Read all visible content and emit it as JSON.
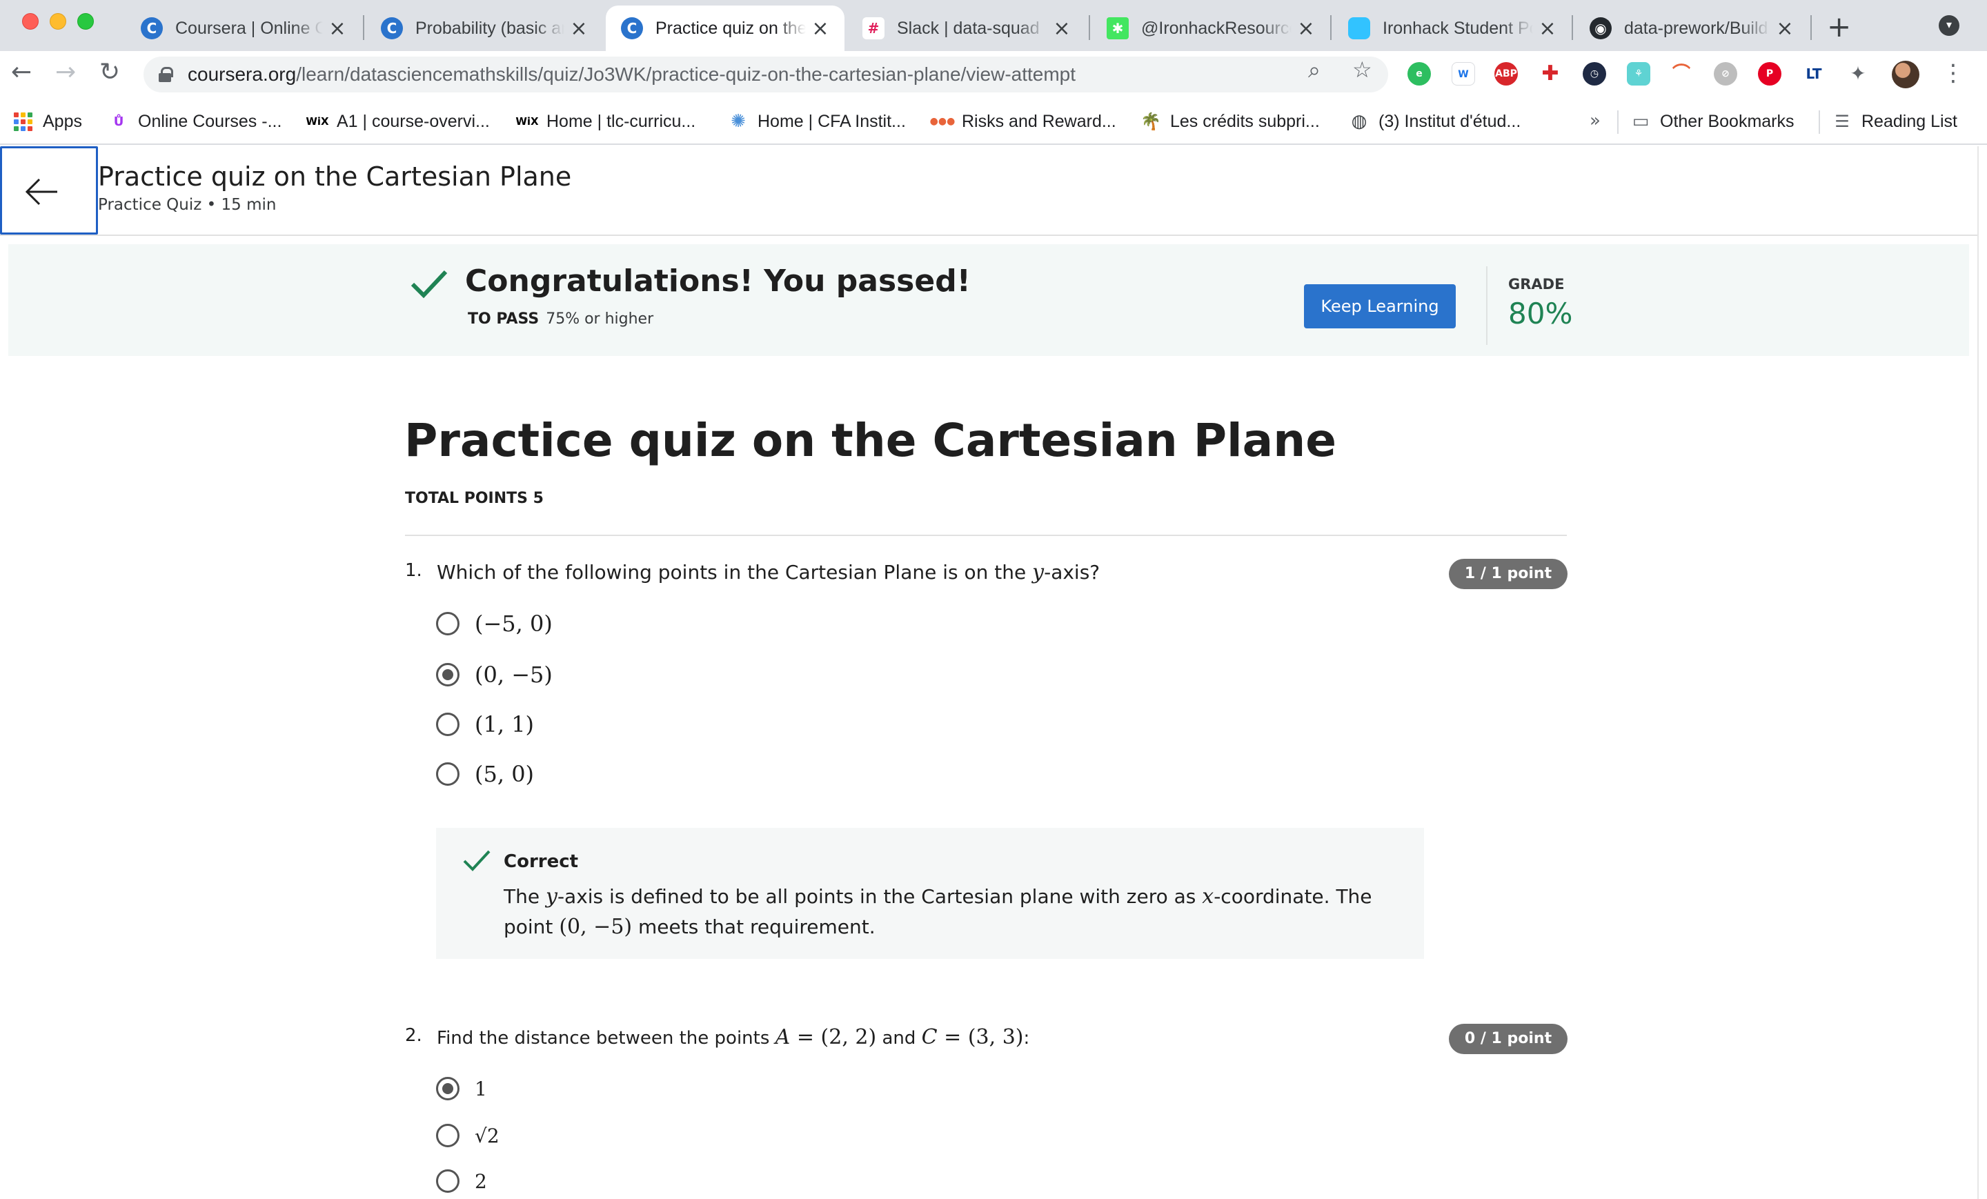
{
  "browser": {
    "tabs": [
      {
        "title": "Coursera | Online Courses",
        "favicon": "coursera-icon",
        "color": "#2a73cc"
      },
      {
        "title": "Probability (basic and advanced)",
        "favicon": "coursera-icon",
        "color": "#2a73cc"
      },
      {
        "title": "Practice quiz on the Cartesian Plane",
        "favicon": "coursera-icon",
        "color": "#2a73cc",
        "active": true
      },
      {
        "title": "Slack | data-squad",
        "favicon": "slack-icon",
        "color": "#e01e5a"
      },
      {
        "title": "@IronhackResources",
        "favicon": "linktree-icon",
        "color": "#43e660"
      },
      {
        "title": "Ironhack Student Portal",
        "favicon": "ironhack-icon",
        "color": "#32c3ff"
      },
      {
        "title": "data-prework/Build",
        "favicon": "github-icon",
        "color": "#24292e"
      }
    ],
    "url_host": "coursera.org",
    "url_path": "/learn/datasciencemathskills/quiz/Jo3WK/practice-quiz-on-the-cartesian-plane/view-attempt",
    "bookmarks": [
      {
        "label": "Apps",
        "icon": "apps-grid-icon"
      },
      {
        "label": "Online Courses -...",
        "icon": "udemy-icon"
      },
      {
        "label": "A1 | course-overvi...",
        "icon": "wix-icon"
      },
      {
        "label": "Home | tlc-curricu...",
        "icon": "wix-icon"
      },
      {
        "label": "Home | CFA Instit...",
        "icon": "cfa-icon"
      },
      {
        "label": "Risks and Reward...",
        "icon": "site-icon"
      },
      {
        "label": "Les crédits subpri...",
        "icon": "palm-icon"
      },
      {
        "label": "(3) Institut d'étud...",
        "icon": "globe-icon"
      },
      {
        "label": "Other Bookmarks",
        "icon": "folder-icon"
      },
      {
        "label": "Reading List",
        "icon": "reading-list-icon"
      }
    ],
    "more_bookmarks": "»"
  },
  "header": {
    "title": "Practice quiz on the Cartesian Plane",
    "subtitle": "Practice Quiz • 15 min"
  },
  "banner": {
    "title": "Congratulations! You passed!",
    "to_pass_label": "TO PASS",
    "to_pass_value": "75% or higher",
    "button": "Keep Learning",
    "grade_label": "GRADE",
    "grade_value": "80%"
  },
  "quiz": {
    "title": "Practice quiz on the Cartesian Plane",
    "total_points": "TOTAL POINTS 5",
    "questions": [
      {
        "number": "1.",
        "text_before": "Which of the following points in the Cartesian Plane is on the ",
        "text_math": "y",
        "text_after": "-axis?",
        "points": "1 / 1 point",
        "options": [
          "(−5, 0)",
          "(0, −5)",
          "(1, 1)",
          "(5, 0)"
        ],
        "selected": 1,
        "feedback": {
          "title": "Correct",
          "body_1": "The ",
          "body_math_1": "y",
          "body_2": "-axis is defined to be all points in the Cartesian plane with zero as ",
          "body_math_2": "x",
          "body_3": "-coordinate. The point ",
          "body_math_3": "(0, −5)",
          "body_4": " meets that requirement."
        }
      },
      {
        "number": "2.",
        "text_before": "Find the distance between the points ",
        "text_math_a": "A",
        "text_eq_a": " = (2, 2)",
        "text_and": " and ",
        "text_math_c": "C",
        "text_eq_c": " = (3, 3)",
        "text_after": ":",
        "points": "0 / 1 point",
        "options": [
          "1",
          "√2",
          "2"
        ],
        "selected": 0
      }
    ]
  },
  "colors": {
    "accent": "#2a73cc",
    "success": "#1f8354",
    "banner_bg": "#f3f8f7",
    "pill_bg": "#6f6f6f"
  }
}
